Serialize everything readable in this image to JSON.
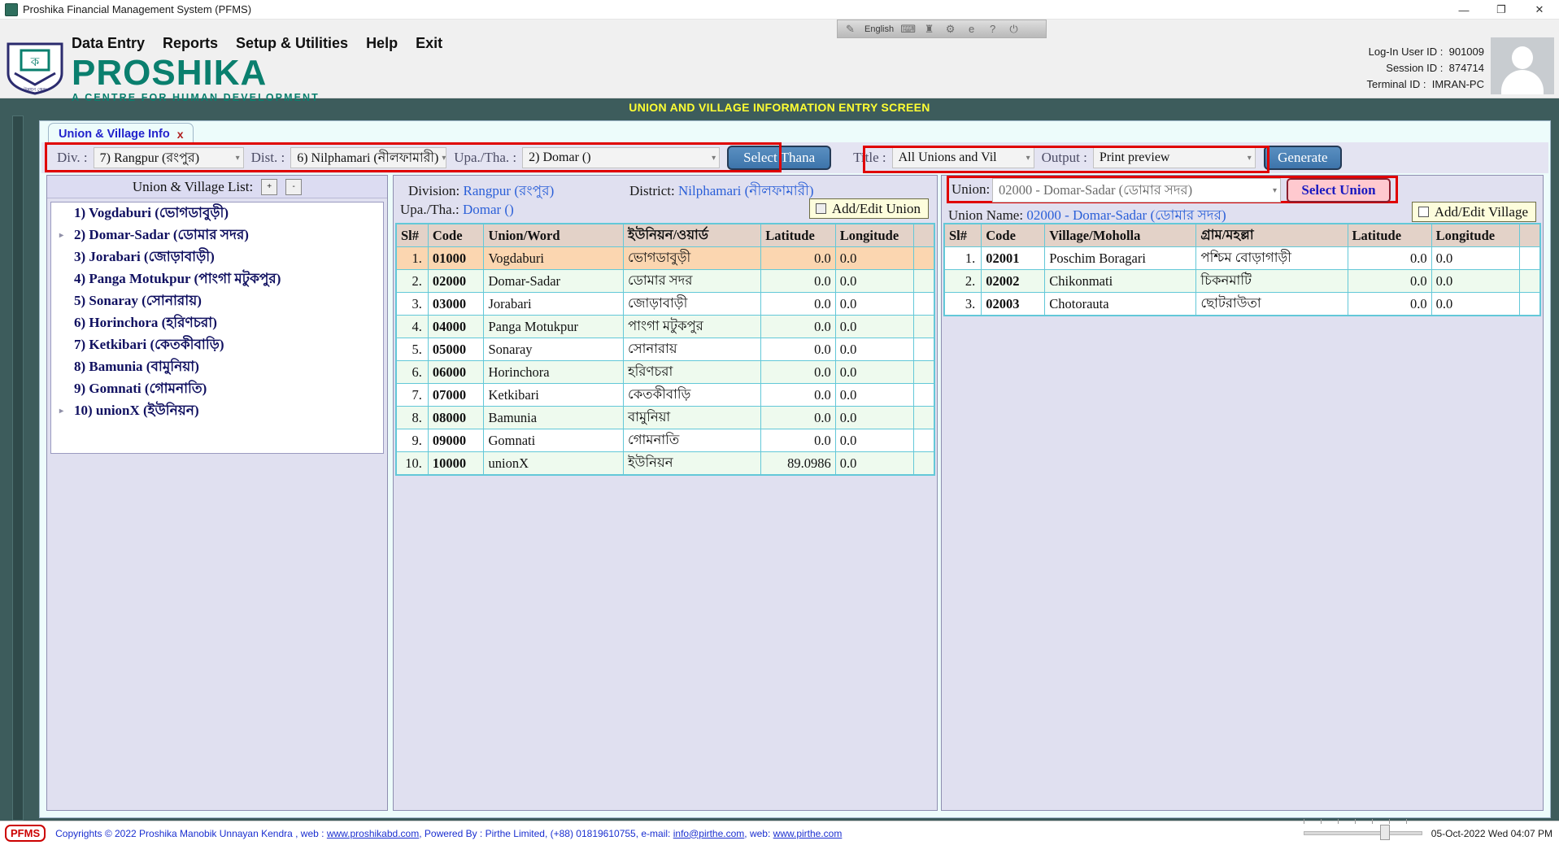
{
  "window": {
    "title": "Proshika Financial Management System (PFMS)",
    "minimize": "—",
    "maximize": "❐",
    "close": "✕"
  },
  "menu": {
    "items": [
      {
        "label": "Data Entry"
      },
      {
        "label": "Reports"
      },
      {
        "label": "Setup & Utilities"
      },
      {
        "label": "Help"
      },
      {
        "label": "Exit"
      }
    ]
  },
  "brand": {
    "name": "PROSHIKA",
    "tagline": "A CENTRE FOR HUMAN DEVELOPMENT"
  },
  "ime": {
    "icon_handwriting": "✎",
    "language": "English",
    "icon_keyboard": "⌨",
    "icon_pad": "♜",
    "icon_gear": "⚙",
    "icon_browser": "e",
    "icon_help": "?",
    "icon_power": "⏻"
  },
  "session": {
    "user_label": "Log-In User ID :",
    "user_value": "901009",
    "session_label": "Session ID :",
    "session_value": "874714",
    "terminal_label": "Terminal ID :",
    "terminal_value": "IMRAN-PC"
  },
  "banner": {
    "title": "UNION AND VILLAGE INFORMATION ENTRY SCREEN"
  },
  "tab": {
    "label": "Union & Village Info",
    "close": "x"
  },
  "toolbar": {
    "div_label": "Div. :",
    "div_value": "7) Rangpur (রংপুর)",
    "dist_label": "Dist. :",
    "dist_value": "6) Nilphamari (নীলফামারী)",
    "upa_label": "Upa./Tha. :",
    "upa_value": "2) Domar ()",
    "select_thana": "Select Thana",
    "title_label": "Title :",
    "title_value": "All Unions and Vil",
    "output_label": "Output :",
    "output_value": "Print preview",
    "generate": "Generate"
  },
  "left_panel": {
    "header": "Union & Village List:",
    "expand_all": "+",
    "collapse_all": "-",
    "items": [
      {
        "label": "1) Vogdaburi (ভোগডাবুড়ী)",
        "expandable": false
      },
      {
        "label": "2) Domar-Sadar (ডোমার সদর)",
        "expandable": true
      },
      {
        "label": "3) Jorabari (জোড়াবাড়ী)",
        "expandable": false
      },
      {
        "label": "4) Panga Motukpur (পাংগা মটুকপুর)",
        "expandable": false
      },
      {
        "label": "5) Sonaray (সোনারায়)",
        "expandable": false
      },
      {
        "label": "6) Horinchora (হরিণচরা)",
        "expandable": false
      },
      {
        "label": "7) Ketkibari (কেতকীবাড়ি)",
        "expandable": false
      },
      {
        "label": "8) Bamunia (বামুনিয়া)",
        "expandable": false
      },
      {
        "label": "9) Gomnati (গোমনাতি)",
        "expandable": false
      },
      {
        "label": "10) unionX (ইউনিয়ন)",
        "expandable": true
      }
    ]
  },
  "mid_panel": {
    "division_label": "Division:",
    "division_value": "Rangpur (রংপুর)",
    "district_label": "District:",
    "district_value": "Nilphamari (নীলফামারী)",
    "upazila_label": "Upa./Tha.:",
    "upazila_value": "Domar ()",
    "add_edit_union": "Add/Edit Union",
    "columns": [
      "Sl#",
      "Code",
      "Union/Word",
      "ইউনিয়ন/ওয়ার্ড",
      "Latitude",
      "Longitude"
    ],
    "rows": [
      {
        "sl": "1.",
        "code": "01000",
        "name": "Vogdaburi",
        "bn": "ভোগডাবুড়ী",
        "lat": "0.0",
        "lon": "0.0",
        "style": "sel"
      },
      {
        "sl": "2.",
        "code": "02000",
        "name": "Domar-Sadar",
        "bn": "ডোমার সদর",
        "lat": "0.0",
        "lon": "0.0",
        "style": "a"
      },
      {
        "sl": "3.",
        "code": "03000",
        "name": "Jorabari",
        "bn": "জোড়াবাড়ী",
        "lat": "0.0",
        "lon": "0.0",
        "style": "b"
      },
      {
        "sl": "4.",
        "code": "04000",
        "name": "Panga Motukpur",
        "bn": "পাংগা মটুকপুর",
        "lat": "0.0",
        "lon": "0.0",
        "style": "a"
      },
      {
        "sl": "5.",
        "code": "05000",
        "name": "Sonaray",
        "bn": "সোনারায়",
        "lat": "0.0",
        "lon": "0.0",
        "style": "b"
      },
      {
        "sl": "6.",
        "code": "06000",
        "name": "Horinchora",
        "bn": "হরিণচরা",
        "lat": "0.0",
        "lon": "0.0",
        "style": "a"
      },
      {
        "sl": "7.",
        "code": "07000",
        "name": "Ketkibari",
        "bn": "কেতকীবাড়ি",
        "lat": "0.0",
        "lon": "0.0",
        "style": "b"
      },
      {
        "sl": "8.",
        "code": "08000",
        "name": "Bamunia",
        "bn": "বামুনিয়া",
        "lat": "0.0",
        "lon": "0.0",
        "style": "a"
      },
      {
        "sl": "9.",
        "code": "09000",
        "name": "Gomnati",
        "bn": "গোমনাতি",
        "lat": "0.0",
        "lon": "0.0",
        "style": "b"
      },
      {
        "sl": "10.",
        "code": "10000",
        "name": "unionX",
        "bn": "ইউনিয়ন",
        "lat": "89.0986",
        "lon": "0.0",
        "style": "a"
      }
    ]
  },
  "right_panel": {
    "union_label": "Union:",
    "union_value": "02000 - Domar-Sadar (ডোমার সদর)",
    "select_union": "Select Union",
    "union_name_label": "Union Name:",
    "union_name_value": "02000 - Domar-Sadar (ডোমার সদর)",
    "add_edit_village": "Add/Edit Village",
    "columns": [
      "Sl#",
      "Code",
      "Village/Moholla",
      "গ্রাম/মহল্লা",
      "Latitude",
      "Longitude"
    ],
    "rows": [
      {
        "sl": "1.",
        "code": "02001",
        "name": "Poschim Boragari",
        "bn": "পশ্চিম বোড়াগাড়ী",
        "lat": "0.0",
        "lon": "0.0",
        "style": "b"
      },
      {
        "sl": "2.",
        "code": "02002",
        "name": "Chikonmati",
        "bn": "চিকনমাটি",
        "lat": "0.0",
        "lon": "0.0",
        "style": "a"
      },
      {
        "sl": "3.",
        "code": "02003",
        "name": "Chotorauta",
        "bn": "ছোটরাউতা",
        "lat": "0.0",
        "lon": "0.0",
        "style": "b"
      }
    ]
  },
  "statusbar": {
    "badge": "PFMS",
    "copyright_pre": "Copyrights © 2022 Proshika Manobik Unnayan Kendra , web : ",
    "link1": "www.proshikabd.com",
    "copyright_mid": ", Powered By : Pirthe Limited, (+88) 01819610755, e-mail: ",
    "link2": "info@pirthe.com",
    "copyright_mid2": ", web: ",
    "link3": "www.pirthe.com",
    "datetime": "05-Oct-2022 Wed 04:07 PM"
  },
  "colors": {
    "brand_green": "#0a7f6e",
    "banner_bg": "#3d5c5c",
    "banner_text": "#ffff33",
    "accent_blue": "#2a5fd8",
    "highlight_row": "#fbd6b0",
    "red_outline": "#e00000"
  }
}
